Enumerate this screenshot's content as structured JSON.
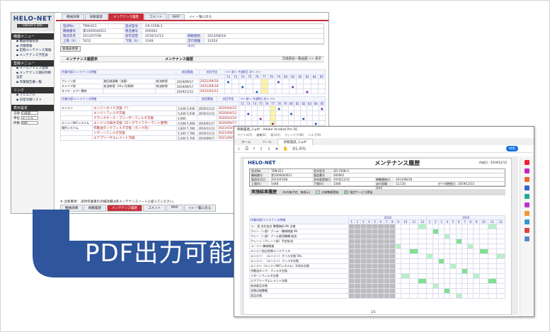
{
  "web_app": {
    "logo": "HELO-NET",
    "logo_tag": "Owner's site",
    "sidebar": {
      "menu_title": "機器メニュー",
      "menu_items": [
        "機器情報照会",
        "点検情報",
        "定期メンテナンス情報",
        "メンテナンス予定表"
      ],
      "settings_title": "登録メニュー",
      "settings_items": [
        "メールアドレス登録",
        "メンテナンス期日判断設定",
        "作業報告書一覧"
      ],
      "links_title": "リンク",
      "links_items": [
        "マニュアル",
        "日常点検リスト"
      ],
      "display_title": "表示設定",
      "form": [
        {
          "label": "言語",
          "value": "日本語"
        },
        {
          "label": "単位",
          "value": "メートル"
        },
        {
          "label": "件数",
          "value": "500"
        }
      ]
    },
    "tabs": [
      "機械詳細",
      "稼動履歴",
      "メンテナンス履歴",
      "コメント",
      "MAP",
      "<< 一覧に戻る"
    ],
    "active_tab": "メンテナンス履歴",
    "info_rows": [
      [
        {
          "k": "型式No",
          "v": "TDN-611"
        },
        {
          "k": "型式型号",
          "v": "GR-150N-3"
        }
      ],
      [
        {
          "k": "機械番号",
          "v": "第10000$0011"
        },
        {
          "k": "製造番号",
          "v": "000062"
        }
      ],
      [
        {
          "k": "製造年月日",
          "v": "2013/07/08"
        },
        {
          "k": "初年度登録日",
          "v": "2016/12/12"
        },
        {
          "k": "稼動開始日",
          "v": "2013/08/18"
        }
      ],
      [
        {
          "k": "上限（h）",
          "v": "5612"
        },
        {
          "k": "下限（h）",
          "v": "3348"
        },
        {
          "k": "走行距離(km)",
          "v": "12054"
        }
      ]
    ],
    "update_button": "管理表更新",
    "section1_title": "メンテナンス履歴表",
    "section1_mid": "メンテナンス履歴",
    "section1_right": "交換部品一覧画面 >> 表示",
    "grid_header": [
      "前回実施",
      "次回予定"
    ],
    "grid_cols": [
      "72",
      "73",
      "74",
      "75",
      "76",
      "77",
      "78",
      "79",
      "80",
      "81",
      "82",
      "83",
      "84",
      "85"
    ],
    "nav_text": "<< 前へ  今週8日  次へ >>",
    "grid1_title": "作業内容/メンテナンス明細",
    "grid1_rows": [
      {
        "name": "クレーン部",
        "sub": "旋回減速機（流量）",
        "item": "給油修理",
        "d1": "2019/09/17",
        "d2": "2021/09/18"
      },
      {
        "name": "キャリア部",
        "sub": "給油修理（24ヶ月周期）",
        "item": "給油修理",
        "d1": "2019/09/17",
        "d2": "2021/09/18"
      },
      {
        "name": "タイヤ・エアー関係",
        "sub": "",
        "item": "",
        "d1": "2019/11/12",
        "d2": "2025/03/12"
      }
    ],
    "grid2_title": "作業内容/メンテナンス明細",
    "grid2_header": [
      "前回実施",
      "次回予定"
    ],
    "grid2_rows": [
      {
        "group": "エンジン",
        "item": "エンジンオイル交換（*）",
        "d1": "2019/11/12",
        "d2": "2020/04/12",
        "v1": "5,436",
        "v2": "5,936"
      },
      {
        "group": "",
        "item": "エンジンフィルタ交換",
        "d1": "2019/11/12",
        "d2": "2020/04/12",
        "v1": "5,436",
        "v2": "5,936"
      },
      {
        "group": "",
        "item": "クランクケース・ブリーザーフィルタ交換",
        "d1": "",
        "d2": "2019/10/10",
        "v1": "",
        "v2": "4,900"
      },
      {
        "group": "エンジンN/Cシステム",
        "item": "エンジン冷却水交換（ロングライフクーラント使用）",
        "d1": "2019/01/17",
        "d2": "2020/09/17",
        "v1": "4,568",
        "v2": "5,068"
      },
      {
        "group": "操作システム",
        "item": "作動油タンクフィルタ交換（タンク内）",
        "d1": "2019/11/12",
        "d2": "2021/03/12",
        "v1": "2,820",
        "v2": "7,780"
      },
      {
        "group": "",
        "item": "リターンフィルタ交換",
        "d1": "2019/11/12",
        "d2": "2021/09/12",
        "v1": "5,300",
        "v2": "7,780"
      },
      {
        "group": "",
        "item": "エアブリーザエレメント交換",
        "d1": "2019/09/17",
        "d2": "2021/09/17",
        "v1": "5,200",
        "v2": "5,760"
      }
    ],
    "footer_note": "※ 注意事項：",
    "footer_note_body": "高所作業車の点検詳細は各メンテナンスノートに従ってください。",
    "footer_tabs": [
      "機械詳細",
      "稼動履歴",
      "メンテナンス履歴",
      "コメント",
      "MAP",
      "<< 一覧に戻る"
    ]
  },
  "arrow_text": "PDF出力可能",
  "pdf_viewer": {
    "title": "移動履歴_2.pdf - Adobe Acrobat Pro DC",
    "menu": [
      "ファイル(F)",
      "編集(E)",
      "表示(V)",
      "ウィンドウ(W)",
      "ヘルプ(H)"
    ],
    "tabs": [
      "ホーム",
      "ツール",
      "移動履歴_2.pdf"
    ],
    "zoom": "91.6%",
    "share_label": "共有",
    "page_logo": "HELO-NET",
    "page_title": "メンテナンス履歴",
    "page_date": "作成日：2019/12/13",
    "page_rows": [
      [
        {
          "k": "型式No",
          "v": "TDN-611"
        },
        {
          "k": "型式型号",
          "v": "GR-150N-3"
        }
      ],
      [
        {
          "k": "機械番号",
          "v": "第10000$0011"
        },
        {
          "k": "製造番号",
          "v": "000062"
        }
      ],
      [
        {
          "k": "製造年月日",
          "v": "2013/07/08"
        },
        {
          "k": "初年度登録日",
          "v": "2016/12/12"
        },
        {
          "k": "稼動開始日",
          "v": "2013/08/18"
        }
      ],
      [
        {
          "k": "上限(h)",
          "v": "5448"
        },
        {
          "k": "下限(h)",
          "v": "3348"
        },
        {
          "k": "走行距離(km)",
          "v": "12,130"
        },
        {
          "k": "データ更新日",
          "v": "2019/12/13"
        }
      ]
    ],
    "section_title": "実施結果履歴",
    "section_hint": "(年内無予定、無指示)",
    "legend1": "点検整備実施",
    "legend2": "指定サービス実施",
    "grid_title": "作業内容/メンテナンス明細",
    "year1": "2018",
    "year2": "2019",
    "months": [
      "1",
      "2",
      "3",
      "4",
      "5",
      "6",
      "7",
      "8",
      "9",
      "10",
      "11",
      "12",
      "1",
      "2",
      "3",
      "4",
      "5",
      "6",
      "7",
      "8",
      "9",
      "10",
      "11",
      "12"
    ],
    "grid_rows": [
      "コ・ 部 支社加点 整備無料 8h 点検",
      "クレー（ン部）ブーム・機械検査 8h",
      "クレー（ン部）ブーム旋回機構 給油",
      "クレーン（クレーン部）予定給油",
      "コ・リン 機械検査",
      "エンジン加点定期メンテナンス",
      "エンジン：（エンジン）オイル交換 5hL",
      "エンジン：（エンジン）フィルタ交換",
      "エンジン（エンジンN/Cシステム）冷却水交換",
      "作動油タンク・フィルタ交換",
      "リターンフィルタ交換",
      "エアブリーザエレメント交換",
      "給油部品交換",
      "定期点検整備",
      "部品交換"
    ],
    "page_number": "1/1"
  }
}
